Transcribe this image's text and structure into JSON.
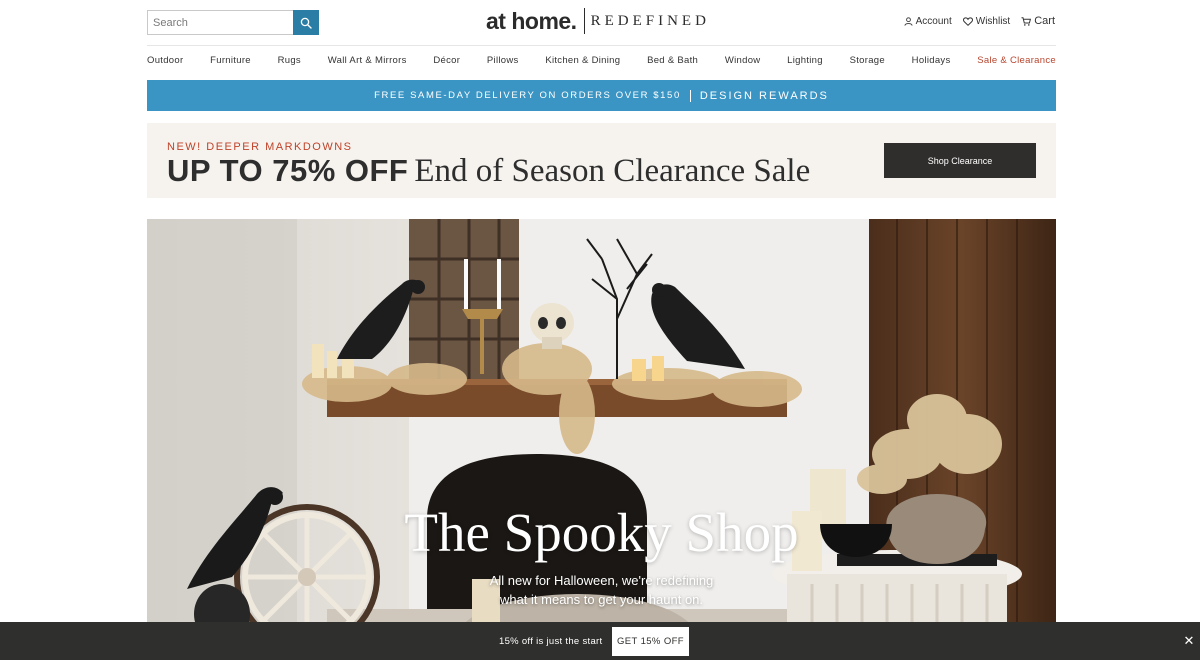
{
  "header": {
    "search_placeholder": "Search",
    "logo_main": "at home.",
    "logo_sub": "REDEFINED",
    "account_label": "Account",
    "wishlist_label": "Wishlist",
    "cart_label": "Cart"
  },
  "nav": {
    "items": [
      "Outdoor",
      "Furniture",
      "Rugs",
      "Wall Art & Mirrors",
      "Décor",
      "Pillows",
      "Kitchen & Dining",
      "Bed & Bath",
      "Window",
      "Lighting",
      "Storage",
      "Holidays",
      "Sale & Clearance"
    ]
  },
  "promo_bar": {
    "delivery_text": "FREE SAME-DAY DELIVERY ON ORDERS OVER $150",
    "rewards_text": "DESIGN REWARDS"
  },
  "clearance": {
    "kicker": "NEW! DEEPER MARKDOWNS",
    "headline_bold": "UP TO 75% OFF",
    "headline_light": "End of Season Clearance Sale",
    "button_label": "Shop Clearance"
  },
  "hero": {
    "title": "The Spooky Shop",
    "subtitle_line1": "All new for Halloween, we're redefining",
    "subtitle_line2": "what it means to get your haunt on."
  },
  "offer_bar": {
    "text": "15% off is just the start",
    "button_label": "GET 15% OFF",
    "close_glyph": "✕"
  },
  "colors": {
    "accent_blue": "#2a7ea5",
    "promo_blue": "#3a95c4",
    "sale_red": "#b8462f",
    "dark": "#2f2e2c"
  }
}
